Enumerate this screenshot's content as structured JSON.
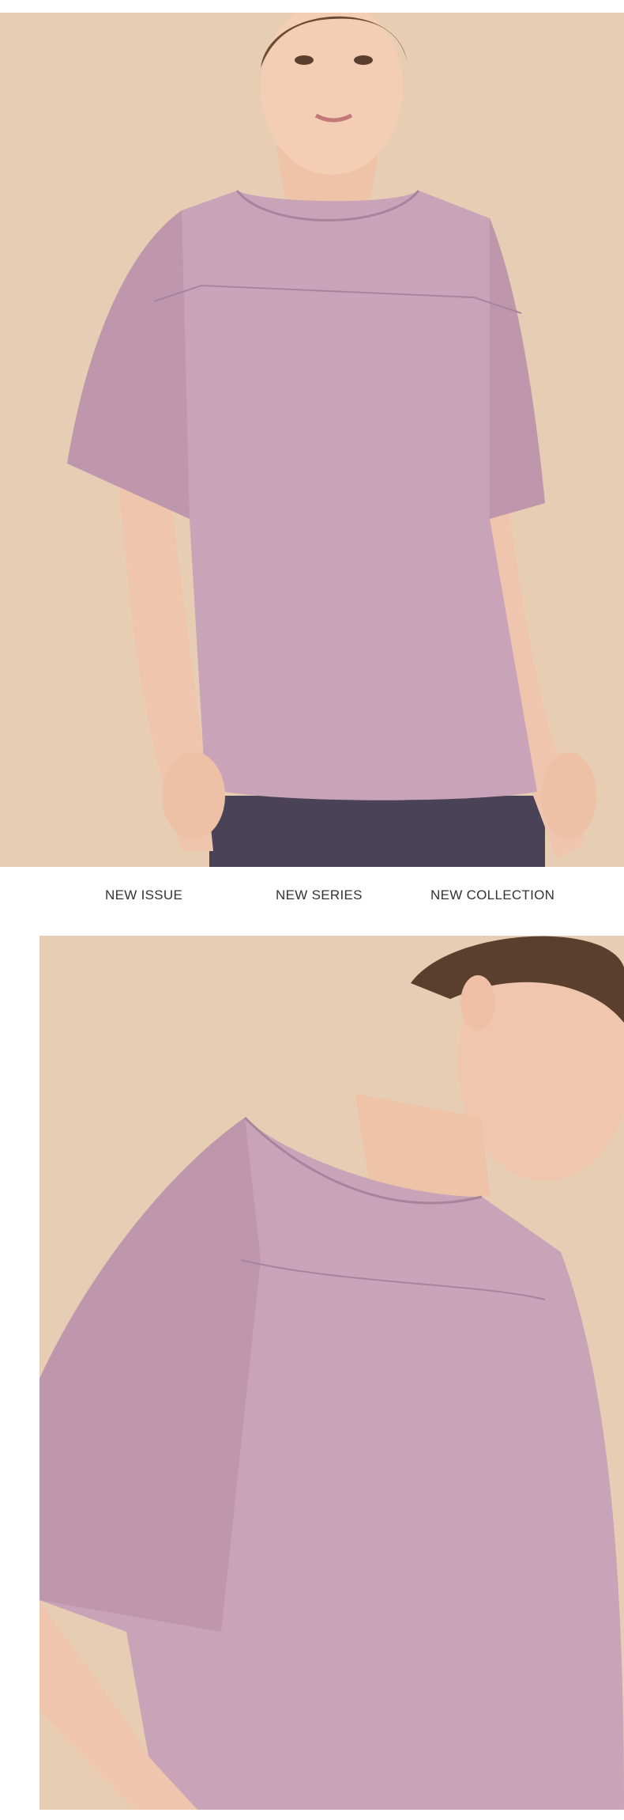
{
  "tabs": [
    {
      "label": "NEW ISSUE"
    },
    {
      "label": "NEW SERIES"
    },
    {
      "label": "NEW COLLECTION"
    }
  ],
  "images": {
    "top": "model-front-view-photo",
    "bottom": "model-side-closeup-photo"
  },
  "colors": {
    "background": "#ffffff",
    "backdrop": "#e6cdb4",
    "shirt": "#c9a3b8",
    "shirt_shadow": "#b48fa4",
    "leggings": "#4a4256",
    "skin": "#f0c8b0",
    "hair": "#5a3e2e",
    "text": "#333333"
  }
}
